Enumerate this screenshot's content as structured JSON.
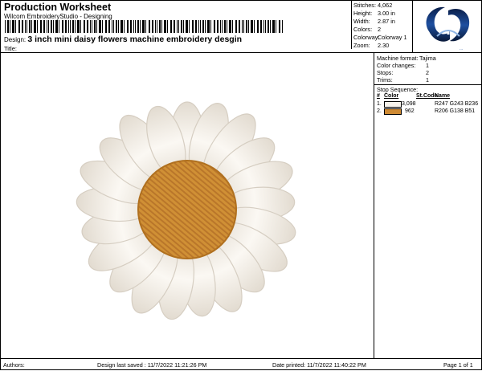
{
  "header": {
    "title": "Production Worksheet",
    "software": "Wilcom EmbroideryStudio - Designing",
    "design_label": "Design:",
    "design_name": "3 inch mini daisy flowers machine embroidery desgin",
    "title_label": "Title:"
  },
  "stats": [
    {
      "label": "Stitches:",
      "value": "4,062"
    },
    {
      "label": "Height:",
      "value": "3.00 in"
    },
    {
      "label": "Width:",
      "value": "2.87 in"
    },
    {
      "label": "Colors:",
      "value": "2"
    },
    {
      "label": "Colorway:",
      "value": "Colorway 1"
    },
    {
      "label": "Zoom:",
      "value": "2.30"
    }
  ],
  "logo_text": "...",
  "machine": [
    {
      "label": "Machine format:",
      "value": "Tajima"
    },
    {
      "label": "Color changes:",
      "value": "1"
    },
    {
      "label": "Stops:",
      "value": "2"
    },
    {
      "label": "Trims:",
      "value": "1"
    }
  ],
  "stop_sequence": {
    "title": "Stop Sequence:",
    "columns": [
      "#",
      "Color",
      "St.",
      "Code",
      "Name"
    ],
    "rows": [
      {
        "num": "1.",
        "color": "#f7f3ec",
        "stitches": "3,098",
        "code": "",
        "name": "R247 G243 B236"
      },
      {
        "num": "2.",
        "color": "#ce8a33",
        "stitches": "962",
        "code": "",
        "name": "R206 G138 B51"
      }
    ]
  },
  "footer": {
    "authors": "Authors:",
    "saved": "Design last saved : 11/7/2022 11:21:26 PM",
    "printed": "Date printed: 11/7/2022 11:40:22 PM",
    "page": "Page 1 of 1"
  },
  "colors": {
    "petal": "#f7f3ec",
    "center": "#ce8a33"
  }
}
